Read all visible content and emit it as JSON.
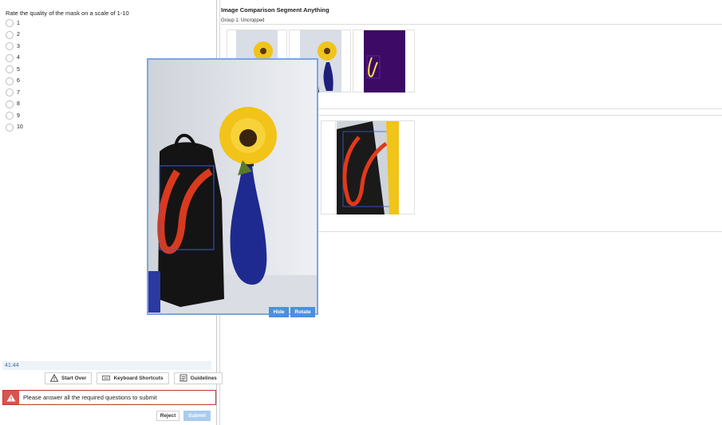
{
  "left": {
    "question": "Rate the quality of the mask on a scale of 1-10",
    "options": [
      "1",
      "2",
      "3",
      "4",
      "5",
      "6",
      "7",
      "8",
      "9",
      "10"
    ],
    "timer": "41:44",
    "buttons": {
      "start_over": "Start Over",
      "keyboard_shortcuts": "Keyboard Shortcuts",
      "guidelines": "Guidelines"
    },
    "alert": "Please answer all the required questions to submit",
    "reject": "Reject",
    "submit": "Submit"
  },
  "right": {
    "title": "Image Comparison Segment Anything",
    "group1_label": "Group 1: Uncropped"
  },
  "overlay": {
    "hide": "Hide",
    "rotate": "Rotate"
  },
  "colors": {
    "accent": "#4a90e2",
    "alert": "#d9534f",
    "submit_disabled": "#aacbed",
    "mask_purple": "#3d0a66",
    "mask_box": "#3b5bd6",
    "mask_red": "#e13a1a"
  }
}
